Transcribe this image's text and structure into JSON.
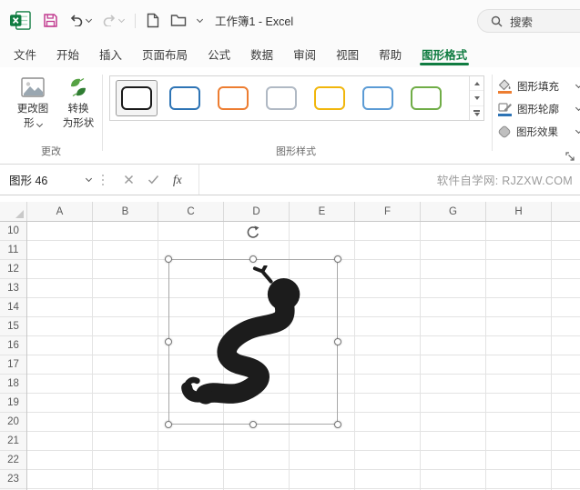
{
  "titlebar": {
    "workbook_title": "工作簿1 - Excel",
    "search_label": "搜索"
  },
  "tabs": [
    {
      "label": "文件"
    },
    {
      "label": "开始"
    },
    {
      "label": "插入"
    },
    {
      "label": "页面布局"
    },
    {
      "label": "公式"
    },
    {
      "label": "数据"
    },
    {
      "label": "审阅"
    },
    {
      "label": "视图"
    },
    {
      "label": "帮助"
    },
    {
      "label": "图形格式"
    }
  ],
  "ribbon": {
    "change_group": {
      "label": "更改",
      "change_graphic_label": "更改图\n形",
      "convert_to_shape_label": "转换\n为形状"
    },
    "styles_group": {
      "label": "图形样式",
      "swatches": [
        {
          "name": "black-outline",
          "border": "#1a1a1a"
        },
        {
          "name": "blue-outline",
          "border": "#2e74b5"
        },
        {
          "name": "orange-outline",
          "border": "#ed7d31"
        },
        {
          "name": "gray-outline",
          "border": "#b0b9c4"
        },
        {
          "name": "gold-outline",
          "border": "#f1b60c"
        },
        {
          "name": "lightblue-outline",
          "border": "#5b9bd5"
        },
        {
          "name": "green-outline",
          "border": "#70ad47"
        }
      ]
    },
    "format_group": {
      "fill_label": "图形填充",
      "outline_label": "图形轮廓",
      "effects_label": "图形效果"
    }
  },
  "formula_bar": {
    "name_box_value": "图形 46",
    "fx_label": "fx",
    "watermark": "软件自学网: RJZXW.COM"
  },
  "sheet": {
    "columns": [
      "A",
      "B",
      "C",
      "D",
      "E",
      "F",
      "G",
      "H"
    ],
    "rows": [
      "10",
      "11",
      "12",
      "13",
      "14",
      "15",
      "16",
      "17",
      "18",
      "19",
      "20",
      "21",
      "22",
      "23"
    ],
    "selected_shape": "snake-graphic"
  },
  "colors": {
    "accent_green": "#107C41",
    "save_icon_magenta": "#C13B8F",
    "snake_black": "#1c1c1c",
    "fill_accent": "#ED7D31",
    "outline_accent": "#2E74B5"
  }
}
